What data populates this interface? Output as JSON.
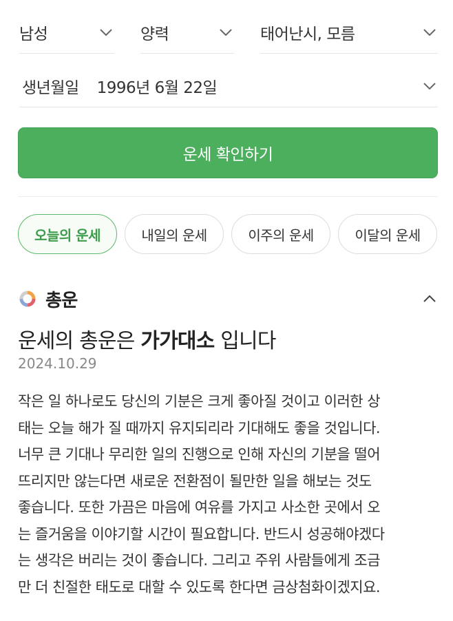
{
  "selectors": {
    "gender": "남성",
    "calendar": "양력",
    "birth_time": "태어난시, 모름"
  },
  "birth": {
    "label": "생년월일",
    "value": "1996년 6월 22일"
  },
  "confirm_button": "운세 확인하기",
  "tabs": [
    {
      "label": "오늘의 운세",
      "active": true
    },
    {
      "label": "내일의 운세",
      "active": false
    },
    {
      "label": "이주의 운세",
      "active": false
    },
    {
      "label": "이달의 운세",
      "active": false
    }
  ],
  "section": {
    "title": "총운",
    "icon": "donut-chart-icon",
    "headline_prefix": "운세의 총운은 ",
    "headline_strong": "가가대소",
    "headline_suffix": " 입니다",
    "date": "2024.10.29",
    "body_lines": [
      "작은 일 하나로도 당신의 기분은 크게 좋아질 것이고 이러한 상",
      "태는 오늘 해가 질 때까지 유지되리라 기대해도 좋을 것입니다.",
      "너무 큰 기대나 무리한 일의 진행으로 인해 자신의 기분을 떨어",
      "뜨리지만 않는다면 새로운 전환점이 될만한 일을 해보는 것도",
      "좋습니다. 또한 가끔은 마음에 여유를 가지고 사소한 곳에서 오",
      "는 즐거움을 이야기할 시간이 필요합니다. 반드시 성공해야겠다",
      "는 생각은 버리는 것이 좋습니다. 그리고 주위 사람들에게 조금",
      "만 더 친절한 태도로 대할 수 있도록 한다면 금상첨화이겠지요."
    ]
  },
  "colors": {
    "accent_green": "#4caf5e",
    "active_tab_text": "#3d9c4b"
  }
}
